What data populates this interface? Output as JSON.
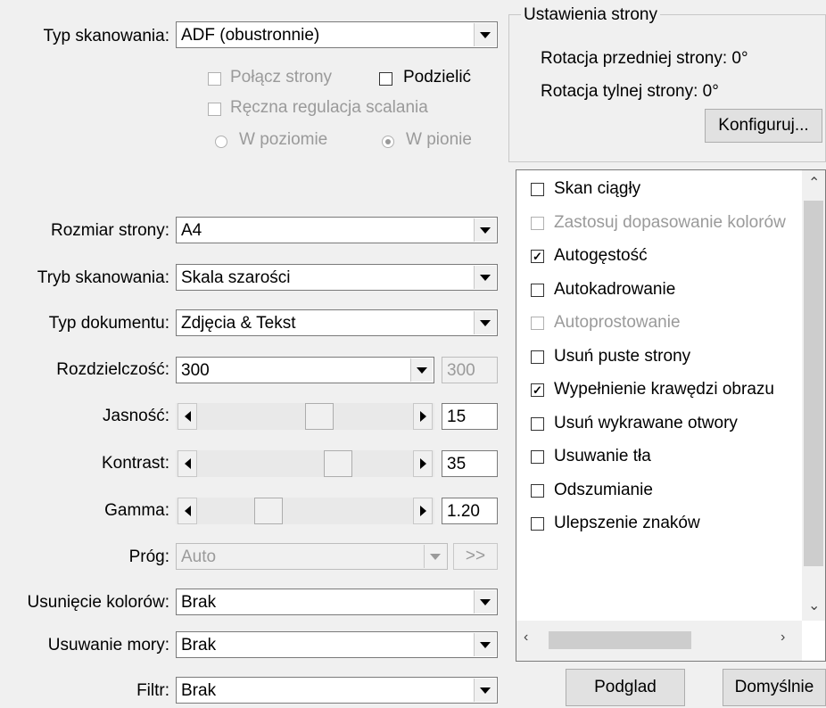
{
  "scan_type": {
    "label": "Typ skanowania:",
    "value": "ADF (obustronnie)"
  },
  "scan_options": {
    "merge_pages": "Połącz strony",
    "split": "Podzielić",
    "manual_merge": "Ręczna regulacja scalania",
    "horizontal": "W poziomie",
    "vertical": "W pionie"
  },
  "page_settings": {
    "title": "Ustawienia strony",
    "front_rotation": "Rotacja przedniej strony: 0°",
    "back_rotation": "Rotacja tylnej strony: 0°",
    "configure_button": "Konfiguruj..."
  },
  "fields": {
    "page_size": {
      "label": "Rozmiar strony:",
      "value": "A4"
    },
    "scan_mode": {
      "label": "Tryb skanowania:",
      "value": "Skala szarości"
    },
    "doc_type": {
      "label": "Typ dokumentu:",
      "value": "Zdjęcia & Tekst"
    },
    "resolution": {
      "label": "Rozdzielczość:",
      "value": "300",
      "custom": "300"
    },
    "brightness": {
      "label": "Jasność:",
      "value": "15"
    },
    "contrast": {
      "label": "Kontrast:",
      "value": "35"
    },
    "gamma": {
      "label": "Gamma:",
      "value": "1.20"
    },
    "threshold": {
      "label": "Próg:",
      "value": "Auto",
      "button": ">>"
    },
    "color_drop": {
      "label": "Usunięcie kolorów:",
      "value": "Brak"
    },
    "moire": {
      "label": "Usuwanie mory:",
      "value": "Brak"
    },
    "filter": {
      "label": "Filtr:",
      "value": "Brak"
    }
  },
  "options_list": [
    {
      "label": "Skan ciągły",
      "checked": false,
      "enabled": true
    },
    {
      "label": "Zastosuj dopasowanie kolorów",
      "checked": false,
      "enabled": false
    },
    {
      "label": "Autogęstość",
      "checked": true,
      "enabled": true
    },
    {
      "label": "Autokadrowanie",
      "checked": false,
      "enabled": true
    },
    {
      "label": "Autoprostowanie",
      "checked": false,
      "enabled": false
    },
    {
      "label": "Usuń puste strony",
      "checked": false,
      "enabled": true
    },
    {
      "label": "Wypełnienie krawędzi obrazu",
      "checked": true,
      "enabled": true
    },
    {
      "label": "Usuń wykrawane otwory",
      "checked": false,
      "enabled": true
    },
    {
      "label": "Usuwanie tła",
      "checked": false,
      "enabled": true
    },
    {
      "label": "Odszumianie",
      "checked": false,
      "enabled": true
    },
    {
      "label": "Ulepszenie znaków",
      "checked": false,
      "enabled": true
    }
  ],
  "buttons": {
    "preview": "Podglad",
    "defaults": "Domyślnie"
  }
}
